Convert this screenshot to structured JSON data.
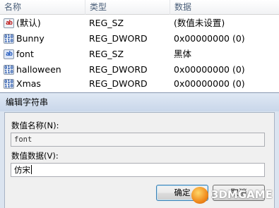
{
  "list": {
    "headers": {
      "name": "名称",
      "type": "类型",
      "data": "数据"
    },
    "rows": [
      {
        "icon": "ab",
        "name": "(默认)",
        "type": "REG_SZ",
        "data": "(数值未设置)"
      },
      {
        "icon": "010 110",
        "name": "Bunny",
        "type": "REG_DWORD",
        "data": "0x00000000 (0)"
      },
      {
        "icon": "ab",
        "name": "font",
        "type": "REG_SZ",
        "data": "黑体"
      },
      {
        "icon": "010 110",
        "name": "halloween",
        "type": "REG_DWORD",
        "data": "0x00000000 (0)"
      },
      {
        "icon": "010 110",
        "name": "Xmas",
        "type": "REG_DWORD",
        "data": "0x00000000 (0)"
      }
    ]
  },
  "dialog": {
    "title": "编辑字符串",
    "value_name_label": "数值名称(N):",
    "value_name": "font",
    "value_data_label": "数值数据(V):",
    "value_data": "仿宋",
    "ok_label": "确定",
    "cancel_label": "取消"
  },
  "watermark": {
    "text": "3DMGAME"
  },
  "colors": {
    "header_text": "#4c607a",
    "dialog_frame": "#dbe4f0",
    "default_button_border": "#3c7fb1"
  }
}
